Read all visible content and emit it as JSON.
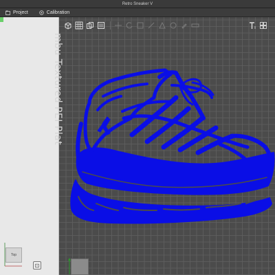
{
  "window": {
    "title": "Retro Sneaker V"
  },
  "tabs": [
    {
      "label": "Project",
      "icon": "project-icon"
    },
    {
      "label": "Calibration",
      "icon": "calibration-icon"
    }
  ],
  "viewport": {
    "plate_label": "mbu Textured PEI Plat",
    "model_color": "#0a0ee6",
    "grid_color": "#616161",
    "background_color": "#4b4b4b"
  },
  "viewcube": {
    "face_label": "Top"
  },
  "toolbar": {
    "icons": [
      "cube-add-icon",
      "grid-layout-icon",
      "copy-icon",
      "list-icon",
      "move-icon",
      "rotate-icon",
      "scale-icon",
      "cut-icon",
      "support-icon",
      "seam-icon",
      "paint-icon",
      "measure-icon",
      "text-icon",
      "assembly-icon"
    ]
  }
}
